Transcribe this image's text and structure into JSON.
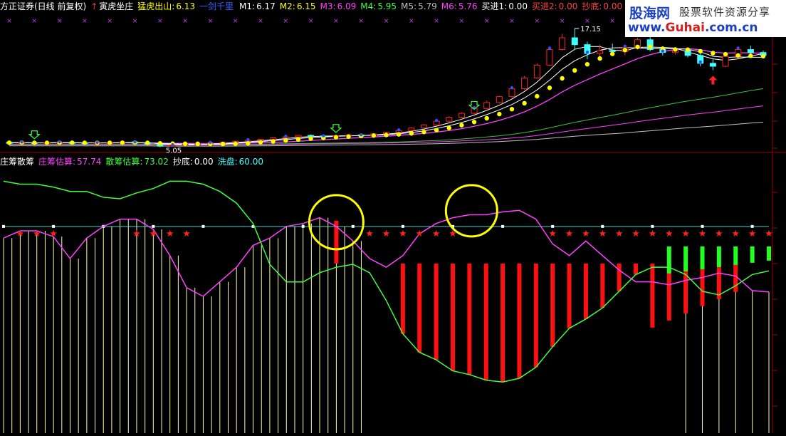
{
  "top_header": {
    "window": "方正证券(日线 前复权)",
    "indicator": "寅虎坐庄",
    "items": [
      {
        "label": "猛虎出山:",
        "value": "6.13",
        "color": "#ffff00"
      },
      {
        "label": "一剑千里",
        "value": "",
        "color": "#3060ff"
      },
      {
        "label": "M1:",
        "value": "6.17",
        "color": "#ffffff"
      },
      {
        "label": "M2:",
        "value": "6.15",
        "color": "#ffff00"
      },
      {
        "label": "M3:",
        "value": "6.09",
        "color": "#ff40ff"
      },
      {
        "label": "M4:",
        "value": "5.95",
        "color": "#40ff40"
      },
      {
        "label": "M5:",
        "value": "5.79",
        "color": "#c0c0c0"
      },
      {
        "label": "M6:",
        "value": "5.76",
        "color": "#ff40ff"
      },
      {
        "label": "买进1:",
        "value": "0.00",
        "color": "#ffffff"
      },
      {
        "label": "买进2:",
        "value": "0.00",
        "color": "#ff4040"
      },
      {
        "label": "抄底:",
        "value": "0.00",
        "color": "#ff4040"
      }
    ]
  },
  "bottom_header": {
    "name": "庄筹散筹",
    "items": [
      {
        "label": "庄筹估算:",
        "value": "57.74",
        "color": "#ff40ff"
      },
      {
        "label": "散筹估算:",
        "value": "73.02",
        "color": "#40ff40"
      },
      {
        "label": "抄底:",
        "value": "0.00",
        "color": "#ffffff"
      },
      {
        "label": "洗盘:",
        "value": "60.00",
        "color": "#40ffff"
      }
    ]
  },
  "logo": {
    "brand": "股海网",
    "slogan": "股票软件资源分享",
    "url_pre": "www.",
    "url_main": "Guhai",
    "url_post": ".com.cn"
  },
  "annotations": {
    "high": "17.15",
    "low": "5.05"
  },
  "colors": {
    "up": "#ff2020",
    "down": "#40ffff",
    "main": "#ff40ff",
    "retail": "#40ff40",
    "yellow": "#ffff00",
    "circle": "#ffff00"
  },
  "chart_data": [
    {
      "type": "candlestick",
      "title": "寅虎坐庄",
      "ylim": [
        4.8,
        18.6
      ],
      "x_count": 61,
      "candles": [
        [
          5.55,
          5.62,
          5.45,
          5.5
        ],
        [
          5.5,
          5.6,
          5.42,
          5.52
        ],
        [
          5.52,
          5.58,
          5.4,
          5.45
        ],
        [
          5.45,
          5.55,
          5.38,
          5.5
        ],
        [
          5.5,
          5.6,
          5.45,
          5.55
        ],
        [
          5.55,
          5.62,
          5.48,
          5.5
        ],
        [
          5.5,
          5.58,
          5.4,
          5.42
        ],
        [
          5.42,
          5.52,
          5.36,
          5.48
        ],
        [
          5.48,
          5.55,
          5.42,
          5.52
        ],
        [
          5.52,
          5.62,
          5.46,
          5.58
        ],
        [
          5.58,
          5.64,
          5.5,
          5.52
        ],
        [
          5.52,
          5.58,
          5.3,
          5.35
        ],
        [
          5.35,
          5.42,
          5.05,
          5.15
        ],
        [
          5.15,
          5.3,
          5.1,
          5.25
        ],
        [
          5.25,
          5.4,
          5.2,
          5.35
        ],
        [
          5.35,
          5.48,
          5.3,
          5.42
        ],
        [
          5.42,
          5.52,
          5.38,
          5.48
        ],
        [
          5.48,
          5.6,
          5.44,
          5.55
        ],
        [
          5.55,
          5.7,
          5.5,
          5.65
        ],
        [
          5.65,
          5.8,
          5.6,
          5.75
        ],
        [
          5.75,
          5.9,
          5.7,
          5.85
        ],
        [
          5.85,
          6.05,
          5.8,
          6.0
        ],
        [
          6.0,
          6.15,
          5.95,
          6.1
        ],
        [
          6.1,
          6.3,
          6.05,
          6.25
        ],
        [
          6.25,
          6.35,
          6.1,
          6.2
        ],
        [
          6.2,
          6.32,
          6.1,
          6.15
        ],
        [
          6.15,
          6.28,
          6.05,
          6.22
        ],
        [
          6.22,
          6.35,
          6.15,
          6.3
        ],
        [
          6.3,
          6.4,
          6.2,
          6.25
        ],
        [
          6.25,
          6.45,
          6.2,
          6.4
        ],
        [
          6.4,
          6.6,
          6.35,
          6.55
        ],
        [
          6.55,
          6.8,
          6.5,
          6.75
        ],
        [
          6.75,
          7.1,
          6.7,
          7.0
        ],
        [
          7.0,
          7.4,
          6.95,
          7.3
        ],
        [
          7.3,
          7.8,
          7.2,
          7.7
        ],
        [
          7.7,
          8.2,
          7.6,
          8.1
        ],
        [
          8.1,
          8.6,
          8.0,
          8.5
        ],
        [
          8.5,
          9.1,
          8.4,
          9.0
        ],
        [
          9.0,
          9.8,
          8.9,
          9.6
        ],
        [
          9.6,
          10.3,
          9.5,
          10.2
        ],
        [
          10.2,
          11.2,
          10.1,
          11.0
        ],
        [
          11.0,
          12.3,
          10.9,
          12.1
        ],
        [
          12.1,
          13.6,
          12.0,
          13.4
        ],
        [
          13.4,
          15.2,
          13.3,
          15.0
        ],
        [
          15.0,
          16.6,
          14.9,
          16.2
        ],
        [
          16.2,
          17.15,
          15.0,
          15.5
        ],
        [
          15.5,
          15.8,
          14.0,
          14.6
        ],
        [
          14.6,
          15.5,
          14.3,
          14.9
        ],
        [
          14.9,
          15.6,
          14.5,
          14.8
        ],
        [
          14.8,
          15.4,
          14.4,
          15.2
        ],
        [
          15.2,
          16.2,
          15.0,
          16.0
        ],
        [
          16.0,
          16.4,
          14.8,
          15.0
        ],
        [
          15.0,
          15.3,
          14.4,
          14.7
        ],
        [
          14.7,
          15.2,
          14.5,
          14.9
        ],
        [
          14.9,
          15.2,
          14.2,
          14.4
        ],
        [
          14.4,
          14.6,
          13.3,
          13.6
        ],
        [
          13.6,
          14.0,
          12.9,
          13.3
        ],
        [
          13.3,
          14.4,
          13.2,
          14.3
        ],
        [
          14.3,
          15.2,
          14.1,
          15.0
        ],
        [
          15.0,
          15.4,
          14.5,
          14.7
        ],
        [
          14.7,
          14.9,
          14.2,
          14.4
        ]
      ],
      "signals": {
        "green_arrows": [
          2,
          26,
          37
        ],
        "red_arrow": [
          56
        ]
      }
    },
    {
      "type": "bar",
      "title": "庄筹散筹",
      "ylim": [
        0,
        100
      ],
      "reference_line": 60,
      "main_chips": [
        52,
        57,
        57,
        53,
        38,
        52,
        60,
        65,
        65,
        58,
        40,
        18,
        12,
        22,
        32,
        47,
        52,
        60,
        62,
        66,
        60,
        50,
        38,
        32,
        40,
        55,
        62,
        66,
        68,
        68,
        70,
        71,
        65,
        48,
        40,
        50,
        40,
        30,
        22,
        22,
        20,
        23,
        25,
        28,
        26,
        16,
        15
      ],
      "retail_chips": [
        79,
        77,
        77,
        75,
        72,
        72,
        68,
        67,
        71,
        74,
        79,
        79,
        77,
        72,
        64,
        50,
        22,
        10,
        10,
        15,
        20,
        22,
        15,
        0,
        -18,
        -28,
        -32,
        -38,
        -40,
        -43,
        -44,
        -42,
        -36,
        -25,
        -15,
        -10,
        -4,
        5,
        14,
        18,
        20,
        14,
        5,
        3,
        8,
        14,
        16
      ],
      "wash_stars": [
        1,
        2,
        3,
        8,
        9,
        10,
        11,
        22,
        23,
        24,
        25,
        26,
        27,
        33,
        34,
        35,
        36,
        37,
        38,
        39,
        40,
        41,
        42,
        43,
        44,
        45,
        46
      ]
    }
  ]
}
